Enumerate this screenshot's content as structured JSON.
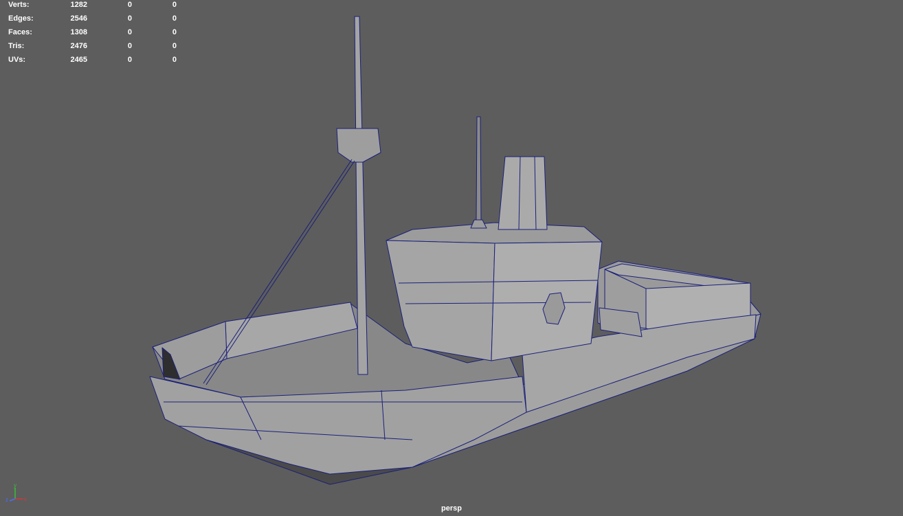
{
  "stats": [
    {
      "label": "Verts:",
      "value": "1282",
      "selected": "0",
      "selected_obj": "0"
    },
    {
      "label": "Edges:",
      "value": "2546",
      "selected": "0",
      "selected_obj": "0"
    },
    {
      "label": "Faces:",
      "value": "1308",
      "selected": "0",
      "selected_obj": "0"
    },
    {
      "label": "Tris:",
      "value": "2476",
      "selected": "0",
      "selected_obj": "0"
    },
    {
      "label": "UVs:",
      "value": "2465",
      "selected": "0",
      "selected_obj": "0"
    }
  ],
  "camera": "persp",
  "axis": {
    "x": "x",
    "y": "y",
    "z": "z"
  },
  "colors": {
    "background": "#5d5d5d",
    "wireframe": "#1a1f7a",
    "surface": "#a3a3a3",
    "axis_x": "#d23a3a",
    "axis_y": "#38c038",
    "axis_z": "#4a6cff"
  },
  "object": "boat-model"
}
